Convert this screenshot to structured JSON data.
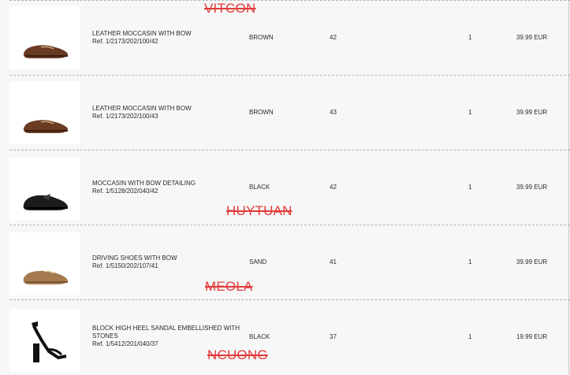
{
  "watermarks": [
    "VITCON",
    "HUYTUAN",
    "MEOLA",
    "NCUONG"
  ],
  "items": [
    {
      "name": "LEATHER MOCCASIN WITH BOW",
      "ref": "Ref. 1/2173/202/100/42",
      "color": "BROWN",
      "size": "42",
      "quantity": "1",
      "price": "39.99 EUR",
      "image": "brown-moccasin-image",
      "shoe_color": "#6b3a22"
    },
    {
      "name": "LEATHER MOCCASIN WITH BOW",
      "ref": "Ref. 1/2173/202/100/43",
      "color": "BROWN",
      "size": "43",
      "quantity": "1",
      "price": "39.99 EUR",
      "image": "brown-moccasin-image",
      "shoe_color": "#6b3a22"
    },
    {
      "name": "MOCCASIN WITH BOW DETAILING",
      "ref": "Ref. 1/5128/202/040/42",
      "color": "BLACK",
      "size": "42",
      "quantity": "1",
      "price": "39.99 EUR",
      "image": "black-moccasin-image",
      "shoe_color": "#1c1c1c"
    },
    {
      "name": "DRIVING SHOES WITH BOW",
      "ref": "Ref. 1/5150/202/107/41",
      "color": "SAND",
      "size": "41",
      "quantity": "1",
      "price": "39.99 EUR",
      "image": "sand-driving-shoe-image",
      "shoe_color": "#a57a4e"
    },
    {
      "name": "BLOCK HIGH HEEL SANDAL EMBELLISHED WITH STONES",
      "ref": "Ref. 1/5412/201/040/37",
      "color": "BLACK",
      "size": "37",
      "quantity": "1",
      "price": "19.99 EUR",
      "image": "black-sandal-image",
      "shoe_color": "#111111"
    }
  ],
  "watermark_color": "#e23b3b"
}
